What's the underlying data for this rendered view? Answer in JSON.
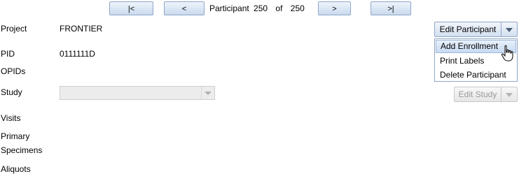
{
  "nav": {
    "first": "|<",
    "prev": "<",
    "participant_label": "Participant",
    "current": "250",
    "of_label": "of",
    "total": "250",
    "next": ">",
    "last": ">|"
  },
  "fields": {
    "project_label": "Project",
    "project_value": "FRONTIER",
    "pid_label": "PID",
    "pid_value": "0111111D",
    "opids_label": "OPIDs",
    "study_label": "Study",
    "visits_label": "Visits",
    "primary_label": "Primary",
    "specimens_label": "Specimens",
    "aliquots_label": "Aliquots"
  },
  "actions": {
    "edit_participant": "Edit Participant",
    "edit_study": "Edit Study"
  },
  "menu": {
    "items": [
      "Add Enrollment",
      "Print Labels",
      "Delete Participant"
    ],
    "hovered_item": "Add Enrollment"
  },
  "icons": {
    "cursor": "hand-pointer-icon",
    "dropdown": "chevron-down-icon"
  }
}
